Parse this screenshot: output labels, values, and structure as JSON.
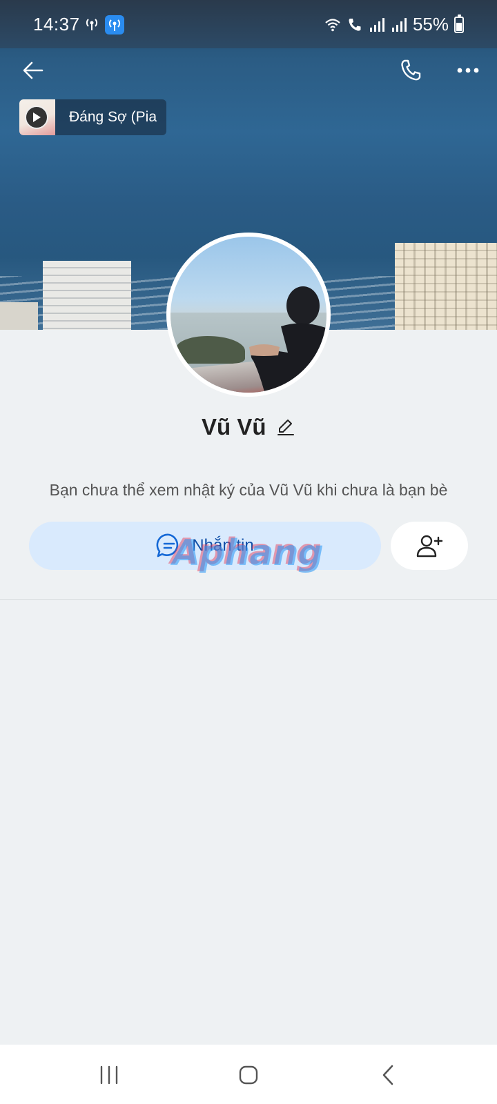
{
  "status_bar": {
    "time": "14:37",
    "battery_text": "55%",
    "icons": [
      "hotspot-icon",
      "app-notification-icon",
      "wifi-icon",
      "wifi-call-icon",
      "signal-icon",
      "signal-icon",
      "battery-charging-icon"
    ]
  },
  "top_bar": {
    "back_icon": "arrow-left-icon",
    "call_icon": "phone-icon",
    "more_icon": "more-horizontal-icon"
  },
  "music": {
    "title": "Đáng Sợ (Pia"
  },
  "profile": {
    "name": "Vũ Vũ",
    "diary_note": "Bạn chưa thể xem nhật ký của Vũ Vũ khi chưa là bạn bè"
  },
  "actions": {
    "message_label": "Nhắn tin",
    "message_icon": "chat-bubble-icon",
    "add_friend_icon": "add-user-icon"
  },
  "watermark": {
    "text": "Aphang"
  },
  "colors": {
    "accent": "#0f4fa8",
    "message_button_bg": "#d9eafd",
    "page_bg": "#eef1f3"
  }
}
